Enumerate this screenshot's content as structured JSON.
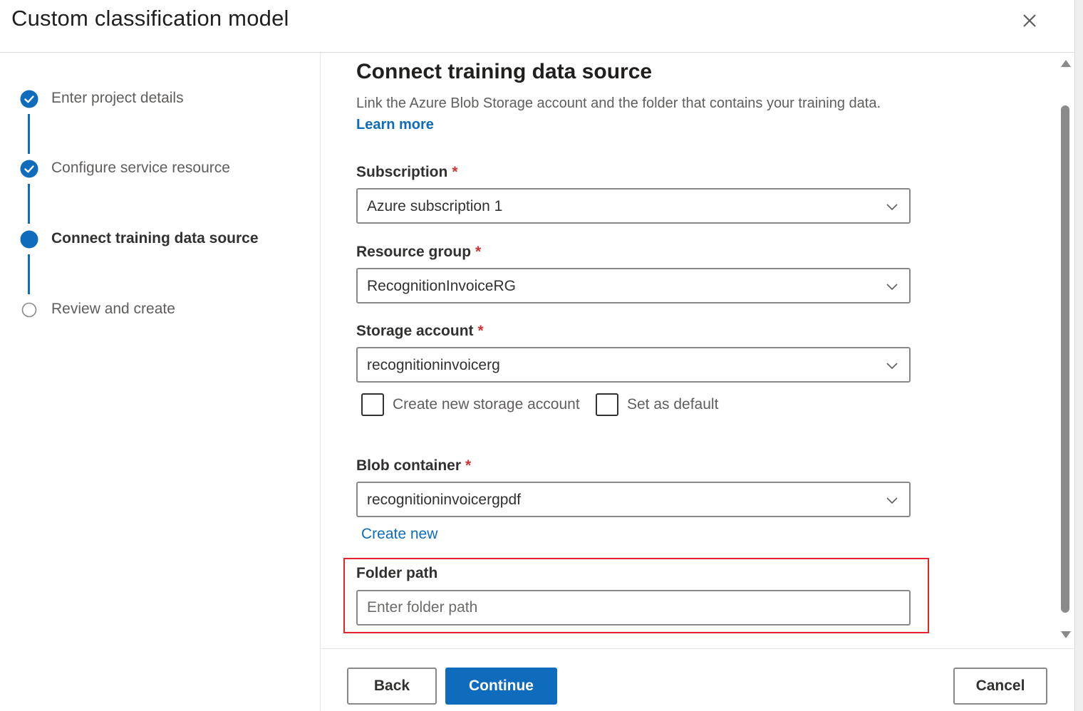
{
  "dialog": {
    "title": "Custom classification model"
  },
  "steps": [
    {
      "label": "Enter project details",
      "status": "completed"
    },
    {
      "label": "Configure service resource",
      "status": "completed"
    },
    {
      "label": "Connect training data source",
      "status": "current"
    },
    {
      "label": "Review and create",
      "status": "pending"
    }
  ],
  "section": {
    "title": "Connect training data source",
    "description": "Link the Azure Blob Storage account and the folder that contains your training data.",
    "learn_more": "Learn more"
  },
  "fields": {
    "subscription": {
      "label": "Subscription",
      "required": "*",
      "value": "Azure subscription 1"
    },
    "resource_group": {
      "label": "Resource group",
      "required": "*",
      "value": "RecognitionInvoiceRG"
    },
    "storage_account": {
      "label": "Storage account",
      "required": "*",
      "value": "recognitioninvoicerg"
    },
    "create_storage_checkbox": {
      "label": "Create new storage account",
      "checked": false
    },
    "set_default_checkbox": {
      "label": "Set as default",
      "checked": false
    },
    "blob_container": {
      "label": "Blob container",
      "required": "*",
      "value": "recognitioninvoicergpdf"
    },
    "create_new_link": "Create new",
    "folder_path": {
      "label": "Folder path",
      "value": "",
      "placeholder": "Enter folder path"
    }
  },
  "footer": {
    "back": "Back",
    "continue": "Continue",
    "cancel": "Cancel"
  },
  "colors": {
    "accent": "#0f6cbd",
    "required": "#d13438",
    "highlight": "#e3242b"
  }
}
